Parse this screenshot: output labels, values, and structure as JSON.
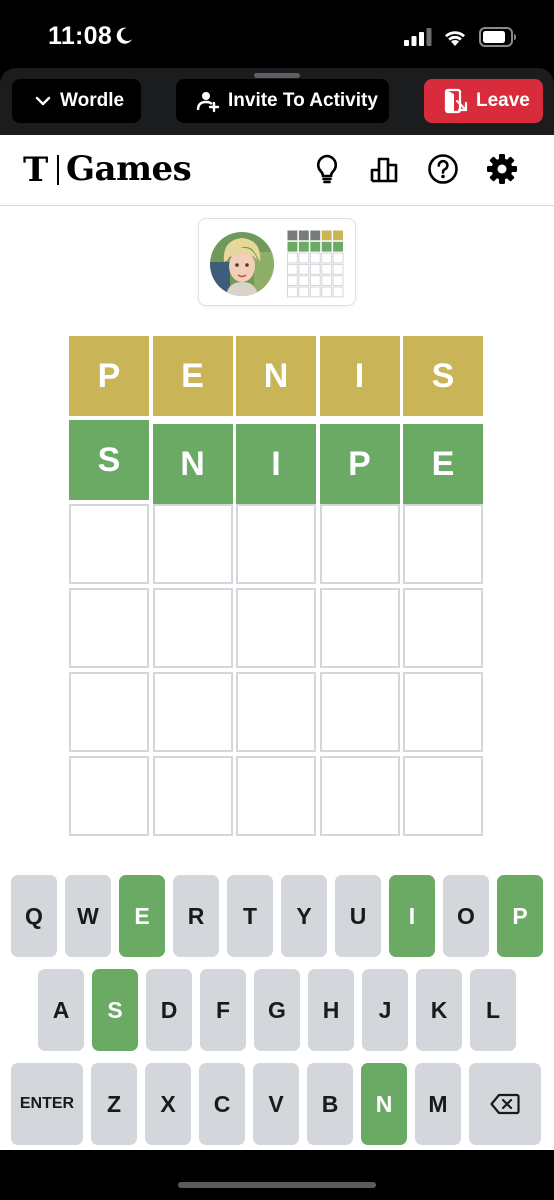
{
  "status_bar": {
    "time": "11:08"
  },
  "activity_bar": {
    "game_button_label": "Wordle",
    "invite_button_label": "Invite To Activity",
    "leave_button_label": "Leave",
    "leave_color": "#d82c3d"
  },
  "header": {
    "logo_mark": "T",
    "brand_title": "Games",
    "icons": [
      "lightbulb-icon",
      "stats-icon",
      "help-icon",
      "gear-icon"
    ]
  },
  "colors": {
    "present": "#c9b458",
    "correct": "#6aaa64",
    "empty_border": "#d3d6da",
    "key_default": "#d3d6da"
  },
  "board": {
    "rows": [
      [
        {
          "letter": "P",
          "state": "present"
        },
        {
          "letter": "E",
          "state": "present"
        },
        {
          "letter": "N",
          "state": "present"
        },
        {
          "letter": "I",
          "state": "present"
        },
        {
          "letter": "S",
          "state": "present"
        }
      ],
      [
        {
          "letter": "S",
          "state": "correct"
        },
        {
          "letter": "N",
          "state": "correct"
        },
        {
          "letter": "I",
          "state": "correct"
        },
        {
          "letter": "P",
          "state": "correct"
        },
        {
          "letter": "E",
          "state": "correct"
        }
      ],
      [
        {
          "letter": "",
          "state": "empty"
        },
        {
          "letter": "",
          "state": "empty"
        },
        {
          "letter": "",
          "state": "empty"
        },
        {
          "letter": "",
          "state": "empty"
        },
        {
          "letter": "",
          "state": "empty"
        }
      ],
      [
        {
          "letter": "",
          "state": "empty"
        },
        {
          "letter": "",
          "state": "empty"
        },
        {
          "letter": "",
          "state": "empty"
        },
        {
          "letter": "",
          "state": "empty"
        },
        {
          "letter": "",
          "state": "empty"
        }
      ],
      [
        {
          "letter": "",
          "state": "empty"
        },
        {
          "letter": "",
          "state": "empty"
        },
        {
          "letter": "",
          "state": "empty"
        },
        {
          "letter": "",
          "state": "empty"
        },
        {
          "letter": "",
          "state": "empty"
        }
      ],
      [
        {
          "letter": "",
          "state": "empty"
        },
        {
          "letter": "",
          "state": "empty"
        },
        {
          "letter": "",
          "state": "empty"
        },
        {
          "letter": "",
          "state": "empty"
        },
        {
          "letter": "",
          "state": "empty"
        }
      ]
    ]
  },
  "keyboard": {
    "rows": [
      [
        {
          "label": "Q"
        },
        {
          "label": "W"
        },
        {
          "label": "E",
          "state": "correct"
        },
        {
          "label": "R"
        },
        {
          "label": "T"
        },
        {
          "label": "Y"
        },
        {
          "label": "U"
        },
        {
          "label": "I",
          "state": "correct"
        },
        {
          "label": "O"
        },
        {
          "label": "P",
          "state": "correct"
        }
      ],
      [
        {
          "label": "A"
        },
        {
          "label": "S",
          "state": "correct"
        },
        {
          "label": "D"
        },
        {
          "label": "F"
        },
        {
          "label": "G"
        },
        {
          "label": "H"
        },
        {
          "label": "J"
        },
        {
          "label": "K"
        },
        {
          "label": "L"
        }
      ],
      [
        {
          "label": "ENTER"
        },
        {
          "label": "Z"
        },
        {
          "label": "X"
        },
        {
          "label": "C"
        },
        {
          "label": "V"
        },
        {
          "label": "B"
        },
        {
          "label": "N",
          "state": "correct"
        },
        {
          "label": "M"
        },
        {
          "label": "",
          "icon": "backspace-icon"
        }
      ]
    ]
  }
}
